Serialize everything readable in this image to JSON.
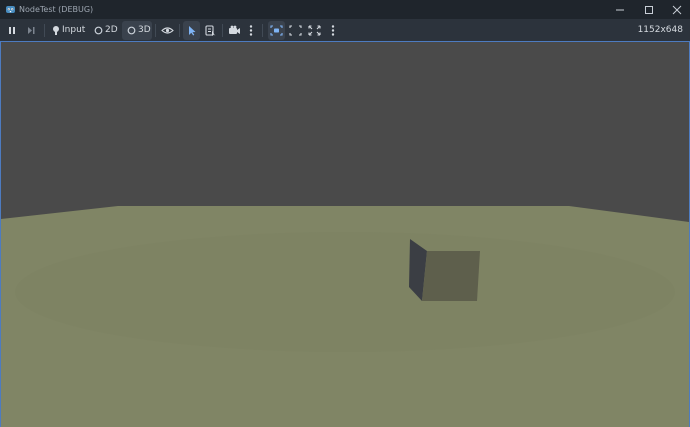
{
  "window": {
    "title": "NodeTest (DEBUG)",
    "controls": {
      "minimize": "minimize-icon",
      "maximize": "maximize-icon",
      "close": "close-icon"
    }
  },
  "toolbar": {
    "pause_icon": "pause-icon",
    "next_frame_icon": "step-frame-icon",
    "input_label": "Input",
    "mode_2d_label": "2D",
    "mode_3d_label": "3D",
    "resolution": "1152x648",
    "active_buttons": [
      "3D",
      "select",
      "camera-focus"
    ]
  },
  "viewport": {
    "sky_color": "#4a4a4a",
    "ground_color": "#808565",
    "cube_front_color": "#5e5f4c",
    "cube_side_color": "#3b3e44"
  },
  "colors": {
    "accent": "#4d7bc0",
    "titlebar_bg": "#1f252c",
    "toolbar_bg": "#2c333c"
  }
}
